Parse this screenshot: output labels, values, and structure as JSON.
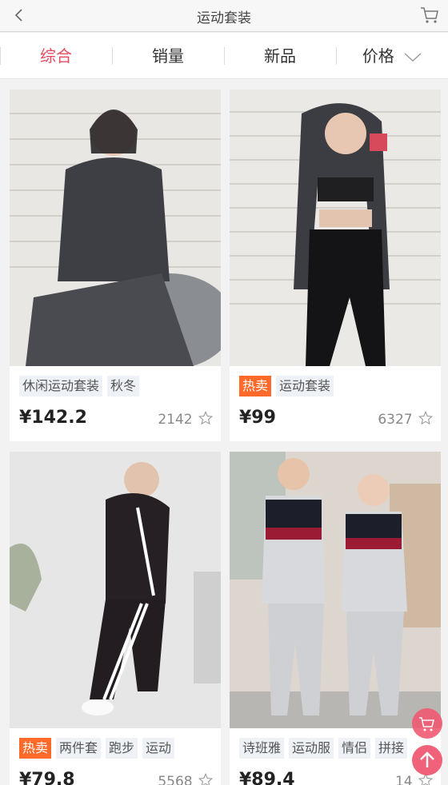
{
  "header": {
    "back_icon": "chevron-left-icon",
    "title": "运动套装",
    "cart_icon": "cart-icon"
  },
  "sort_tabs": [
    {
      "label": "综合",
      "active": true
    },
    {
      "label": "销量",
      "active": false
    },
    {
      "label": "新品",
      "active": false
    },
    {
      "label": "价格",
      "active": false,
      "icon": "chevron-down-icon"
    }
  ],
  "products": [
    {
      "tags": [
        {
          "text": "休闲运动套装",
          "hot": false
        },
        {
          "text": "秋冬",
          "hot": false
        }
      ],
      "price": "¥142.2",
      "sales": "2142"
    },
    {
      "tags": [
        {
          "text": "热卖",
          "hot": true
        },
        {
          "text": "运动套装",
          "hot": false
        }
      ],
      "price": "¥99",
      "sales": "6327"
    },
    {
      "tags": [
        {
          "text": "热卖",
          "hot": true
        },
        {
          "text": "两件套",
          "hot": false
        },
        {
          "text": "跑步",
          "hot": false
        },
        {
          "text": "运动",
          "hot": false
        }
      ],
      "price": "¥79.8",
      "sales": "5568"
    },
    {
      "tags": [
        {
          "text": "诗班雅",
          "hot": false
        },
        {
          "text": "运动服",
          "hot": false
        },
        {
          "text": "情侣",
          "hot": false
        },
        {
          "text": "拼接",
          "hot": false
        }
      ],
      "price": "¥89.4",
      "sales": "14"
    }
  ],
  "floating": {
    "cart_icon": "cart-icon",
    "back_to_top_icon": "arrow-up-icon"
  },
  "colors": {
    "accent": "#e84a5f",
    "hot_tag": "#ff6a2a",
    "fab": "#f05a72"
  }
}
